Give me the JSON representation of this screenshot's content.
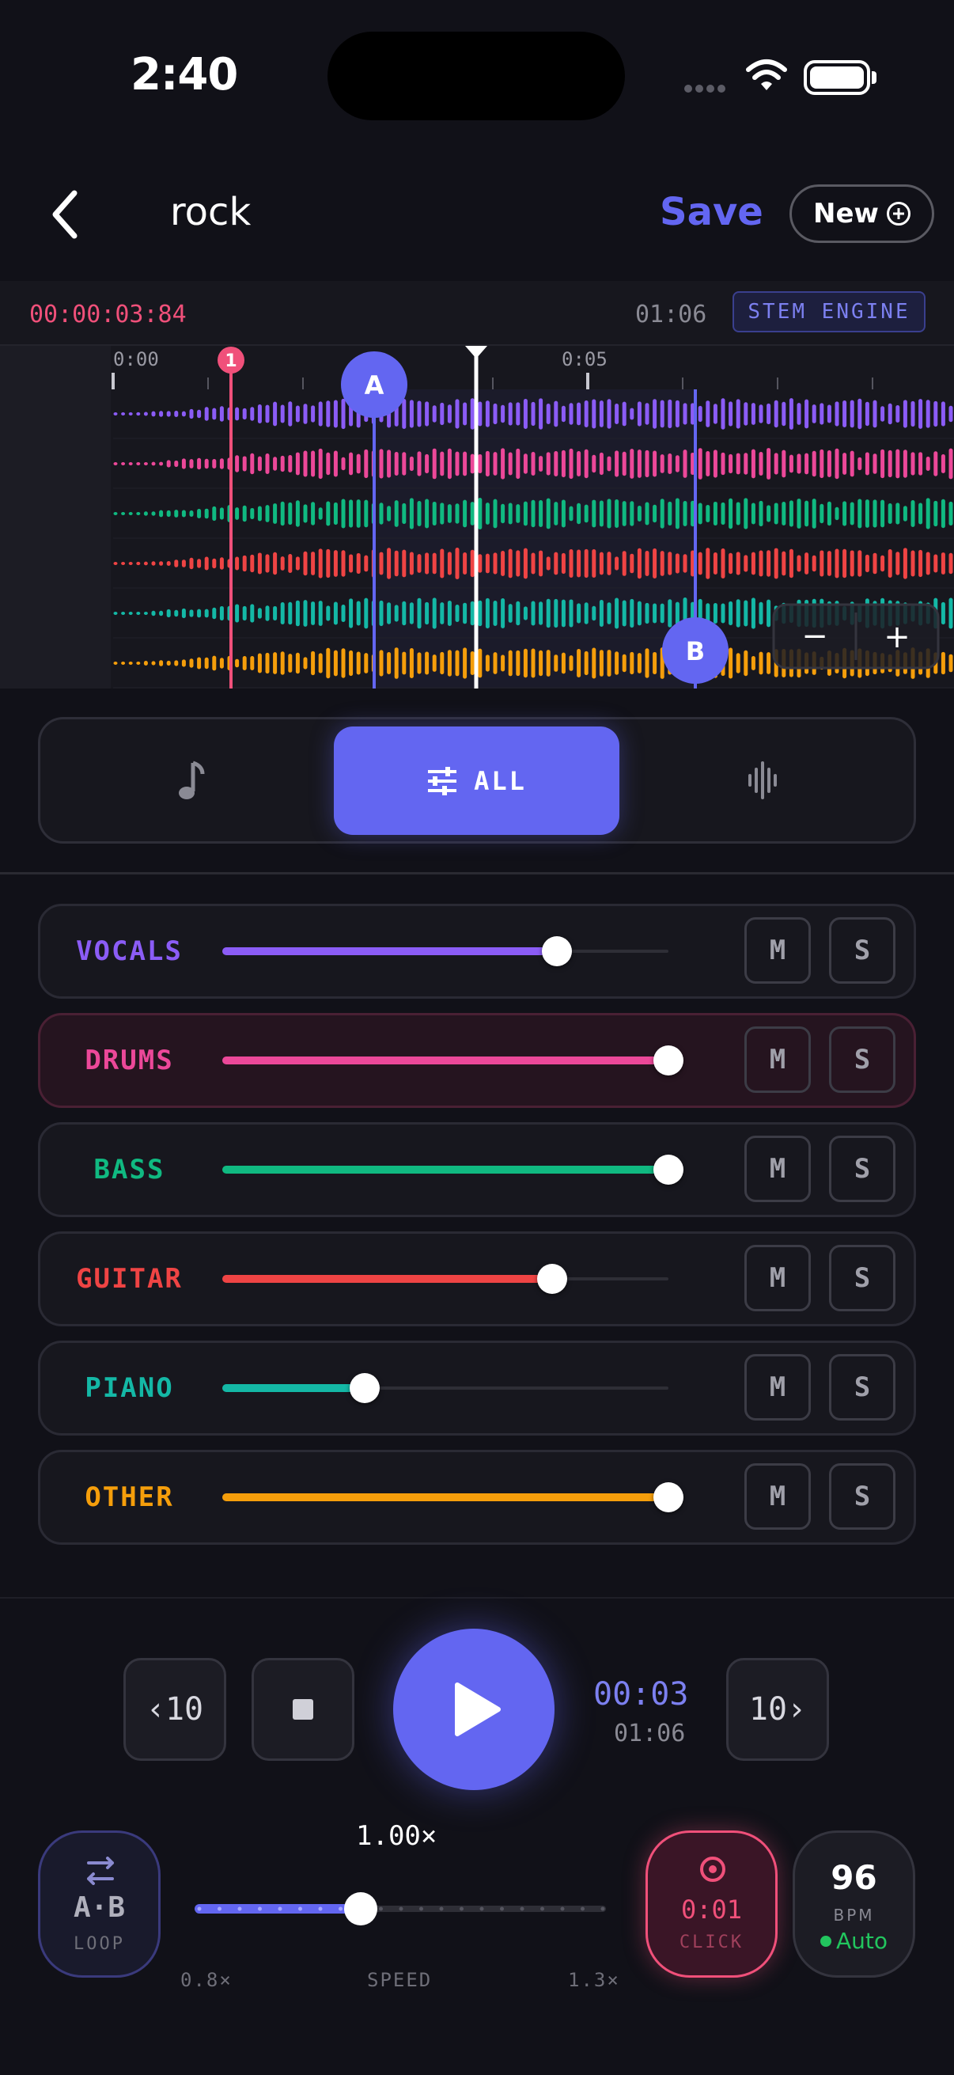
{
  "status_bar": {
    "time": "2:40"
  },
  "nav": {
    "title": "rock",
    "save_label": "Save",
    "new_label": "New"
  },
  "timeline": {
    "timecode": "00:00:03:84",
    "duration": "01:06",
    "engine_label": "STEM ENGINE",
    "ruler_labels": [
      "0:00",
      "0:05"
    ],
    "marker_number": "1",
    "loop_start_label": "A",
    "loop_end_label": "B",
    "zoom_out": "−",
    "zoom_in": "+"
  },
  "mode_selector": {
    "active_label": "ALL",
    "active_icon": "sliders-icon",
    "left_icon": "music-note-icon",
    "right_icon": "waveform-icon"
  },
  "stems": [
    {
      "name": "VOCALS",
      "level": 0.75,
      "color": "#8b5cf6",
      "mute": "M",
      "solo": "S",
      "active": false
    },
    {
      "name": "DRUMS",
      "level": 1.0,
      "color": "#ec4899",
      "mute": "M",
      "solo": "S",
      "active": true
    },
    {
      "name": "BASS",
      "level": 1.0,
      "color": "#10b981",
      "mute": "M",
      "solo": "S",
      "active": false
    },
    {
      "name": "GUITAR",
      "level": 0.74,
      "color": "#ef4444",
      "mute": "M",
      "solo": "S",
      "active": false
    },
    {
      "name": "PIANO",
      "level": 0.32,
      "color": "#14b8a6",
      "mute": "M",
      "solo": "S",
      "active": false
    },
    {
      "name": "OTHER",
      "level": 1.0,
      "color": "#f59e0b",
      "mute": "M",
      "solo": "S",
      "active": false
    }
  ],
  "transport": {
    "rewind_label": "‹10",
    "forward_label": "10›",
    "position": "00:03",
    "duration": "01:06"
  },
  "loop": {
    "label": "A·B",
    "sublabel": "LOOP"
  },
  "speed": {
    "value_label": "1.00×",
    "value": 1.0,
    "min_label": "0.8×",
    "label": "SPEED",
    "max_label": "1.3×",
    "min": 0.8,
    "max": 1.3
  },
  "click": {
    "time": "0:01",
    "label": "CLICK"
  },
  "bpm": {
    "value": "96",
    "label": "BPM",
    "mode": "Auto"
  },
  "colors": {
    "accent": "#6366f1",
    "marker": "#f0507a",
    "background": "#111118"
  }
}
